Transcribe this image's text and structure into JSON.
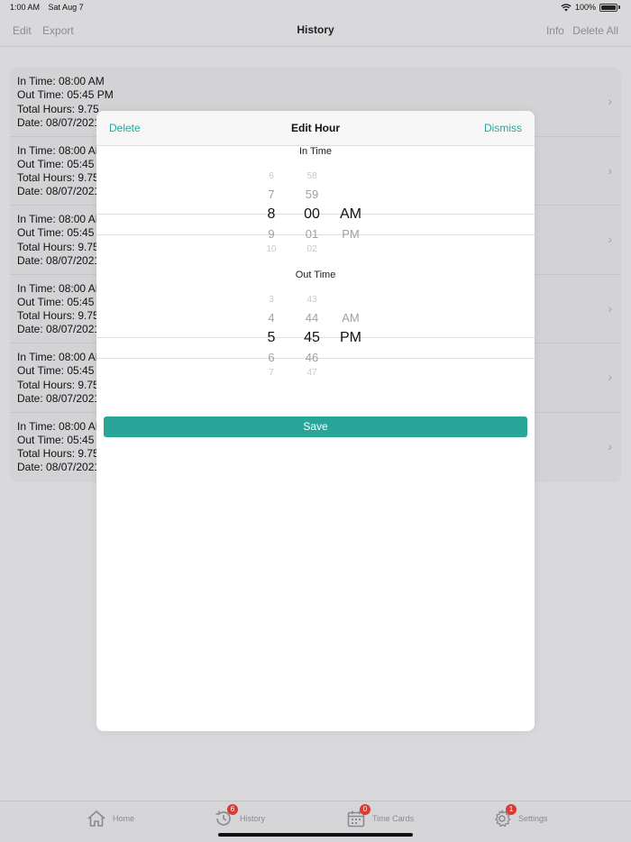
{
  "status": {
    "time": "1:00 AM",
    "date": "Sat Aug 7",
    "battery": "100%"
  },
  "nav": {
    "edit": "Edit",
    "export": "Export",
    "title": "History",
    "info": "Info",
    "delete_all": "Delete All"
  },
  "list": {
    "rows": [
      {
        "in": "In Time: 08:00 AM",
        "out": "Out Time: 05:45 PM",
        "total": "Total Hours: 9.75",
        "date": "Date: 08/07/2021"
      },
      {
        "in": "In Time: 08:00 AM",
        "out": "Out Time: 05:45 PM",
        "total": "Total Hours: 9.75",
        "date": "Date: 08/07/2021"
      },
      {
        "in": "In Time: 08:00 AM",
        "out": "Out Time: 05:45 PM",
        "total": "Total Hours: 9.75",
        "date": "Date: 08/07/2021"
      },
      {
        "in": "In Time: 08:00 AM",
        "out": "Out Time: 05:45 PM",
        "total": "Total Hours: 9.75",
        "date": "Date: 08/07/2021"
      },
      {
        "in": "In Time: 08:00 AM",
        "out": "Out Time: 05:45 PM",
        "total": "Total Hours: 9.75",
        "date": "Date: 08/07/2021"
      },
      {
        "in": "In Time: 08:00 AM",
        "out": "Out Time: 05:45 PM",
        "total": "Total Hours: 9.75",
        "date": "Date: 08/07/2021"
      }
    ],
    "chevron": "›"
  },
  "modal": {
    "delete": "Delete",
    "title": "Edit Hour",
    "dismiss": "Dismiss",
    "in_label": "In Time",
    "out_label": "Out Time",
    "save": "Save",
    "in_picker": {
      "hours": [
        "6",
        "7",
        "8",
        "9",
        "10"
      ],
      "minutes": [
        "58",
        "59",
        "00",
        "01",
        "02"
      ],
      "ampm": [
        "",
        "",
        "AM",
        "PM",
        ""
      ]
    },
    "out_picker": {
      "hours": [
        "3",
        "4",
        "5",
        "6",
        "7"
      ],
      "minutes": [
        "43",
        "44",
        "45",
        "46",
        "47"
      ],
      "ampm": [
        "",
        "AM",
        "PM",
        "",
        ""
      ]
    }
  },
  "tabs": {
    "home": "Home",
    "history": "History",
    "history_badge": "6",
    "timecards": "Time Cards",
    "timecards_badge": "0",
    "settings": "Settings",
    "settings_badge": "1"
  }
}
